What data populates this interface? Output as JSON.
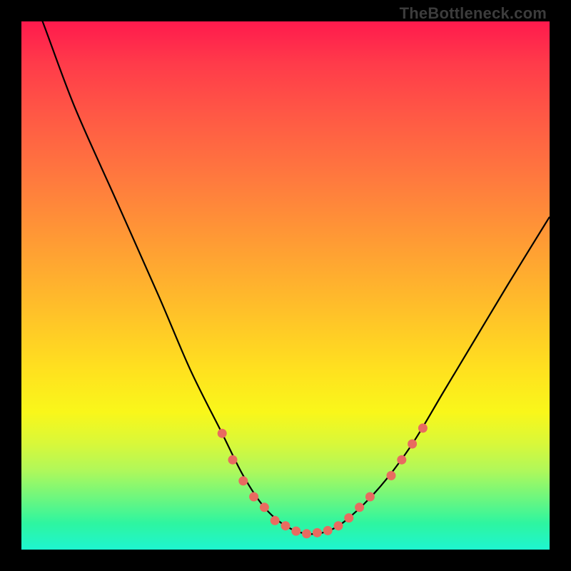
{
  "attribution": "TheBottleneck.com",
  "chart_data": {
    "type": "line",
    "title": "",
    "xlabel": "",
    "ylabel": "",
    "xlim": [
      0,
      100
    ],
    "ylim": [
      0,
      100
    ],
    "series": [
      {
        "name": "bottleneck-curve",
        "x": [
          0,
          4,
          10,
          18,
          26,
          32,
          38,
          42,
          46,
          50,
          54,
          58,
          62,
          68,
          74,
          80,
          86,
          92,
          100
        ],
        "values": [
          110,
          100,
          84,
          66,
          48,
          34,
          22,
          14,
          8,
          4.5,
          3,
          3.5,
          6,
          12,
          20,
          30,
          40,
          50,
          63
        ]
      }
    ],
    "markers": {
      "name": "highlight-dots",
      "color": "#e86b60",
      "x": [
        38,
        40,
        42,
        44,
        46,
        48,
        50,
        52,
        54,
        56,
        58,
        60,
        62,
        64,
        66,
        70,
        72,
        74,
        76
      ],
      "values": [
        22,
        17,
        13,
        10,
        8,
        5.5,
        4.5,
        3.5,
        3,
        3.2,
        3.6,
        4.5,
        6,
        8,
        10,
        14,
        17,
        20,
        23
      ]
    },
    "green_band_y": 5
  }
}
